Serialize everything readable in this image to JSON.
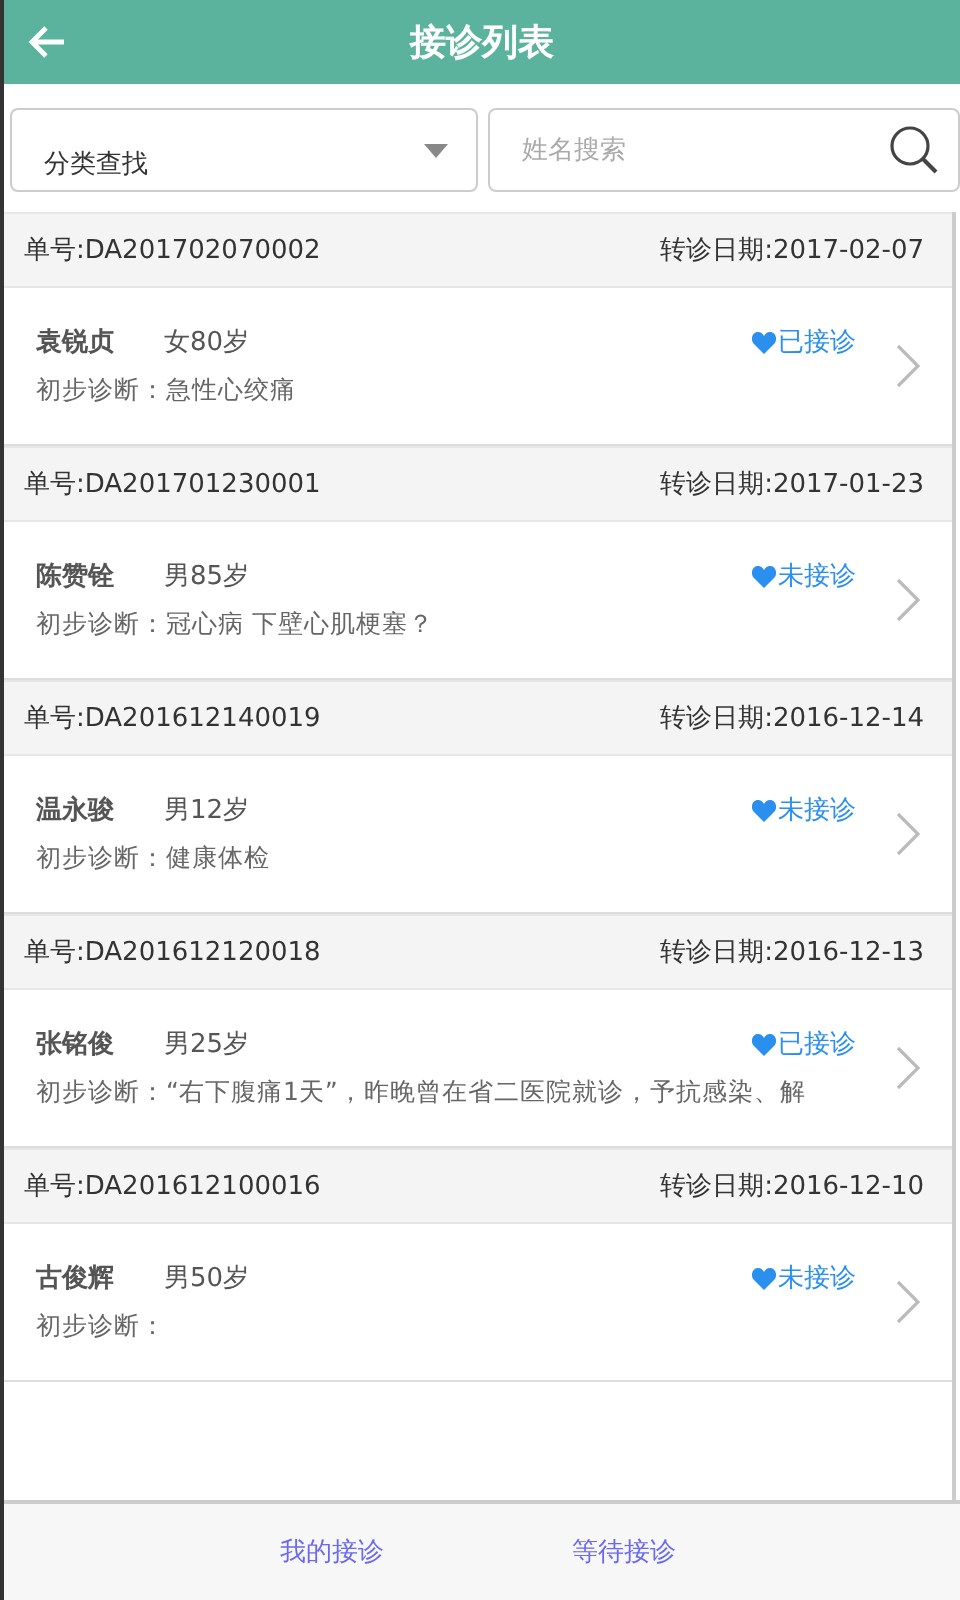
{
  "header": {
    "title": "接诊列表"
  },
  "filter": {
    "value": "分类查找"
  },
  "search": {
    "placeholder": "姓名搜索"
  },
  "records": [
    {
      "number": "单号:DA201702070002",
      "date": "转诊日期:2017-02-07",
      "name": "袁锐贞",
      "info": "女80岁",
      "status": "已接诊",
      "diagnosis": "初步诊断：急性心绞痛"
    },
    {
      "number": "单号:DA201701230001",
      "date": "转诊日期:2017-01-23",
      "name": "陈赞铨",
      "info": "男85岁",
      "status": "未接诊",
      "diagnosis": "初步诊断：冠心病 下壁心肌梗塞？"
    },
    {
      "number": "单号:DA201612140019",
      "date": "转诊日期:2016-12-14",
      "name": "温永骏",
      "info": "男12岁",
      "status": "未接诊",
      "diagnosis": "初步诊断：健康体检"
    },
    {
      "number": "单号:DA201612120018",
      "date": "转诊日期:2016-12-13",
      "name": "张铭俊",
      "info": "男25岁",
      "status": "已接诊",
      "diagnosis": "初步诊断：“右下腹痛1天”，昨晚曾在省二医院就诊，予抗感染、解"
    },
    {
      "number": "单号:DA201612100016",
      "date": "转诊日期:2016-12-10",
      "name": "古俊辉",
      "info": "男50岁",
      "status": "未接诊",
      "diagnosis": "初步诊断："
    }
  ],
  "bottom_tabs": [
    "我的接诊",
    "等待接诊"
  ]
}
